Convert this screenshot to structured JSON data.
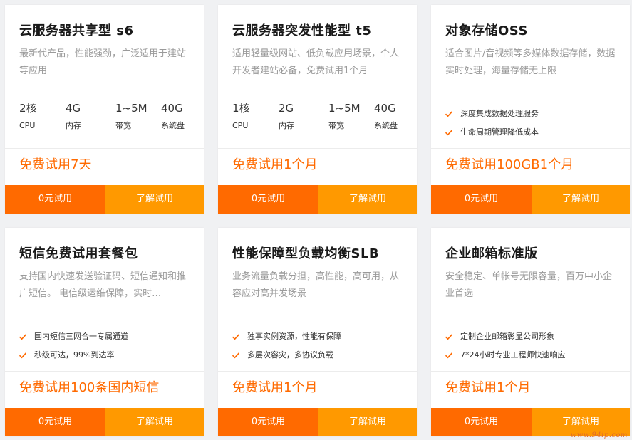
{
  "colors": {
    "accent": "#ff6a00",
    "accent_light": "#ff9900",
    "title": "#1a1a1a",
    "desc": "#9a9a9a",
    "background": "#f0f1f3"
  },
  "cards": [
    {
      "title": "云服务器共享型 s6",
      "desc": "最新代产品，性能强劲，广泛适用于建站等应用",
      "specs": [
        {
          "value": "2核",
          "label": "CPU"
        },
        {
          "value": "4G",
          "label": "内存"
        },
        {
          "value": "1~5M",
          "label": "带宽"
        },
        {
          "value": "40G",
          "label": "系统盘"
        }
      ],
      "promo": "免费试用7天",
      "trial_label": "0元试用",
      "learn_label": "了解试用"
    },
    {
      "title": "云服务器突发性能型 t5",
      "desc": "适用轻量级网站、低负载应用场景，个人开发者建站必备，免费试用1个月",
      "specs": [
        {
          "value": "1核",
          "label": "CPU"
        },
        {
          "value": "2G",
          "label": "内存"
        },
        {
          "value": "1~5M",
          "label": "带宽"
        },
        {
          "value": "40G",
          "label": "系统盘"
        }
      ],
      "promo": "免费试用1个月",
      "trial_label": "0元试用",
      "learn_label": "了解试用"
    },
    {
      "title": "对象存储OSS",
      "desc": "适合图片/音视频等多媒体数据存储，数据实时处理，海量存储无上限",
      "features": [
        "深度集成数据处理服务",
        "生命周期管理降低成本"
      ],
      "promo": "免费试用100GB1个月",
      "trial_label": "0元试用",
      "learn_label": "了解试用"
    },
    {
      "title": "短信免费试用套餐包",
      "desc": "支持国内快速发送验证码、短信通知和推广短信。 电信级运维保障，实时…",
      "features": [
        "国内短信三网合一专属通道",
        "秒级可达，99%到达率"
      ],
      "promo": "免费试用100条国内短信",
      "trial_label": "0元试用",
      "learn_label": "了解试用"
    },
    {
      "title": "性能保障型负载均衡SLB",
      "desc": "业务流量负载分担，高性能，高可用，从容应对高并发场景",
      "features": [
        "独享实例资源，性能有保障",
        "多层次容灾，多协议负载"
      ],
      "promo": "免费试用1个月",
      "trial_label": "0元试用",
      "learn_label": "了解试用"
    },
    {
      "title": "企业邮箱标准版",
      "desc": "安全稳定、单帐号无限容量，百万中小企业首选",
      "features": [
        "定制企业邮箱彰显公司形象",
        "7*24小时专业工程师快速响应"
      ],
      "promo": "免费试用1个月",
      "trial_label": "0元试用",
      "learn_label": "了解试用"
    }
  ],
  "watermark": "www.94ip.com"
}
